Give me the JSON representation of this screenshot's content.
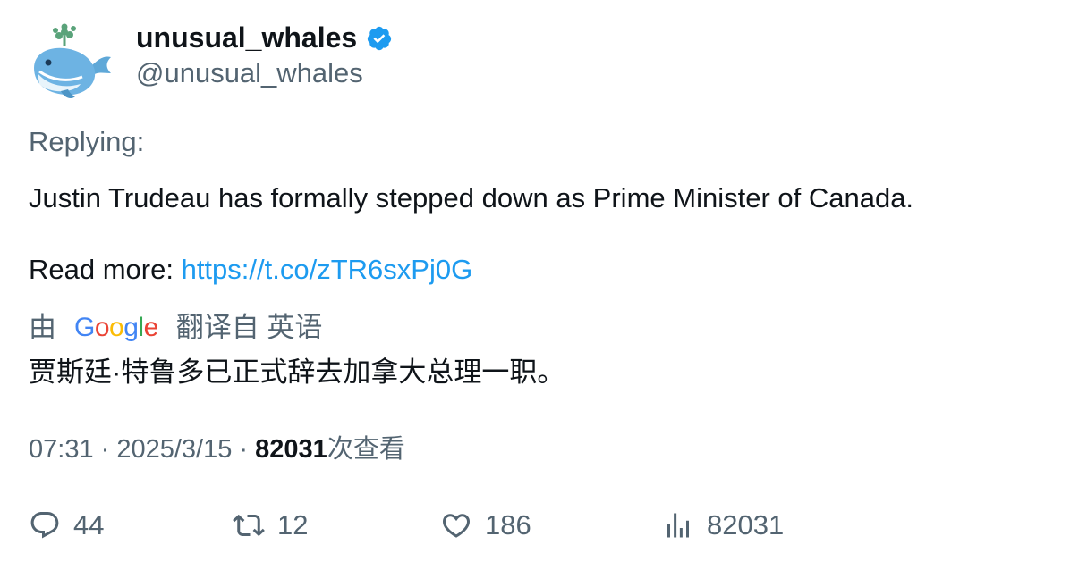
{
  "author": {
    "display_name": "unusual_whales",
    "handle": "@unusual_whales",
    "verified_icon": "verified-badge-icon",
    "avatar_icon": "whale-avatar"
  },
  "tweet": {
    "replying_label": "Replying:",
    "text": "Justin Trudeau has formally stepped down as Prime Minister of Canada.",
    "read_more_label": "Read more: ",
    "link": "https://t.co/zTR6sxPj0G"
  },
  "translation": {
    "prefix": "由",
    "provider_letters": [
      "G",
      "o",
      "o",
      "g",
      "l",
      "e"
    ],
    "suffix": "翻译自 英语",
    "text": "贾斯廷·特鲁多已正式辞去加拿大总理一职。"
  },
  "meta": {
    "time": "07:31",
    "separator": " · ",
    "date": "2025/3/15",
    "views_count": "82031",
    "views_label": "次查看"
  },
  "actions": {
    "replies": "44",
    "retweets": "12",
    "likes": "186",
    "views": "82031"
  },
  "colors": {
    "link": "#1d9bf0",
    "secondary_text": "#536471",
    "primary_text": "#0f1419",
    "verified": "#1d9bf0"
  }
}
